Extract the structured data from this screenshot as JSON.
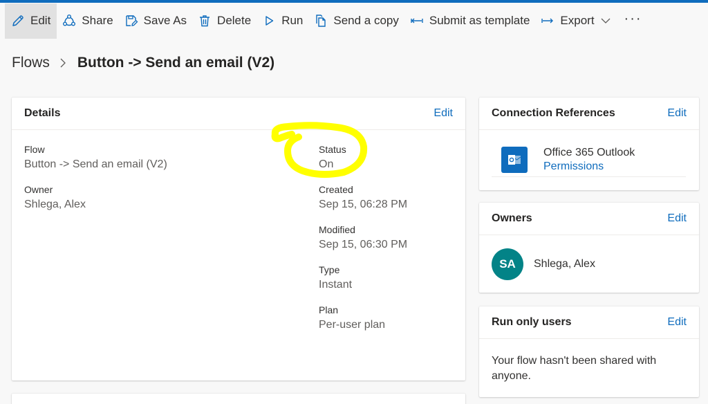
{
  "toolbar": {
    "edit": "Edit",
    "share": "Share",
    "save_as": "Save As",
    "delete": "Delete",
    "run": "Run",
    "send_copy": "Send a copy",
    "submit_template": "Submit as template",
    "export": "Export",
    "more": "···"
  },
  "breadcrumb": {
    "parent": "Flows",
    "current": "Button -> Send an email (V2)"
  },
  "details": {
    "title": "Details",
    "edit": "Edit",
    "flow_label": "Flow",
    "flow_value": "Button -> Send an email (V2)",
    "owner_label": "Owner",
    "owner_value": "Shlega, Alex",
    "status_label": "Status",
    "status_value": "On",
    "created_label": "Created",
    "created_value": "Sep 15, 06:28 PM",
    "modified_label": "Modified",
    "modified_value": "Sep 15, 06:30 PM",
    "type_label": "Type",
    "type_value": "Instant",
    "plan_label": "Plan",
    "plan_value": "Per-user plan"
  },
  "connections": {
    "title": "Connection References",
    "edit": "Edit",
    "name": "Office 365 Outlook",
    "permissions": "Permissions"
  },
  "owners": {
    "title": "Owners",
    "edit": "Edit",
    "initials": "SA",
    "name": "Shlega, Alex"
  },
  "run_only": {
    "title": "Run only users",
    "edit": "Edit",
    "message": "Your flow hasn't been shared with anyone."
  },
  "icons": {
    "edit": "pencil-icon",
    "share": "share-icon",
    "save_as": "save-as-icon",
    "delete": "trash-icon",
    "run": "play-icon",
    "send_copy": "copy-icon",
    "submit_template": "submit-arrow-icon",
    "export": "export-icon",
    "outlook": "outlook-icon"
  },
  "colors": {
    "accent": "#0f6cbd",
    "avatar": "#038387",
    "highlight": "#ffff00"
  }
}
